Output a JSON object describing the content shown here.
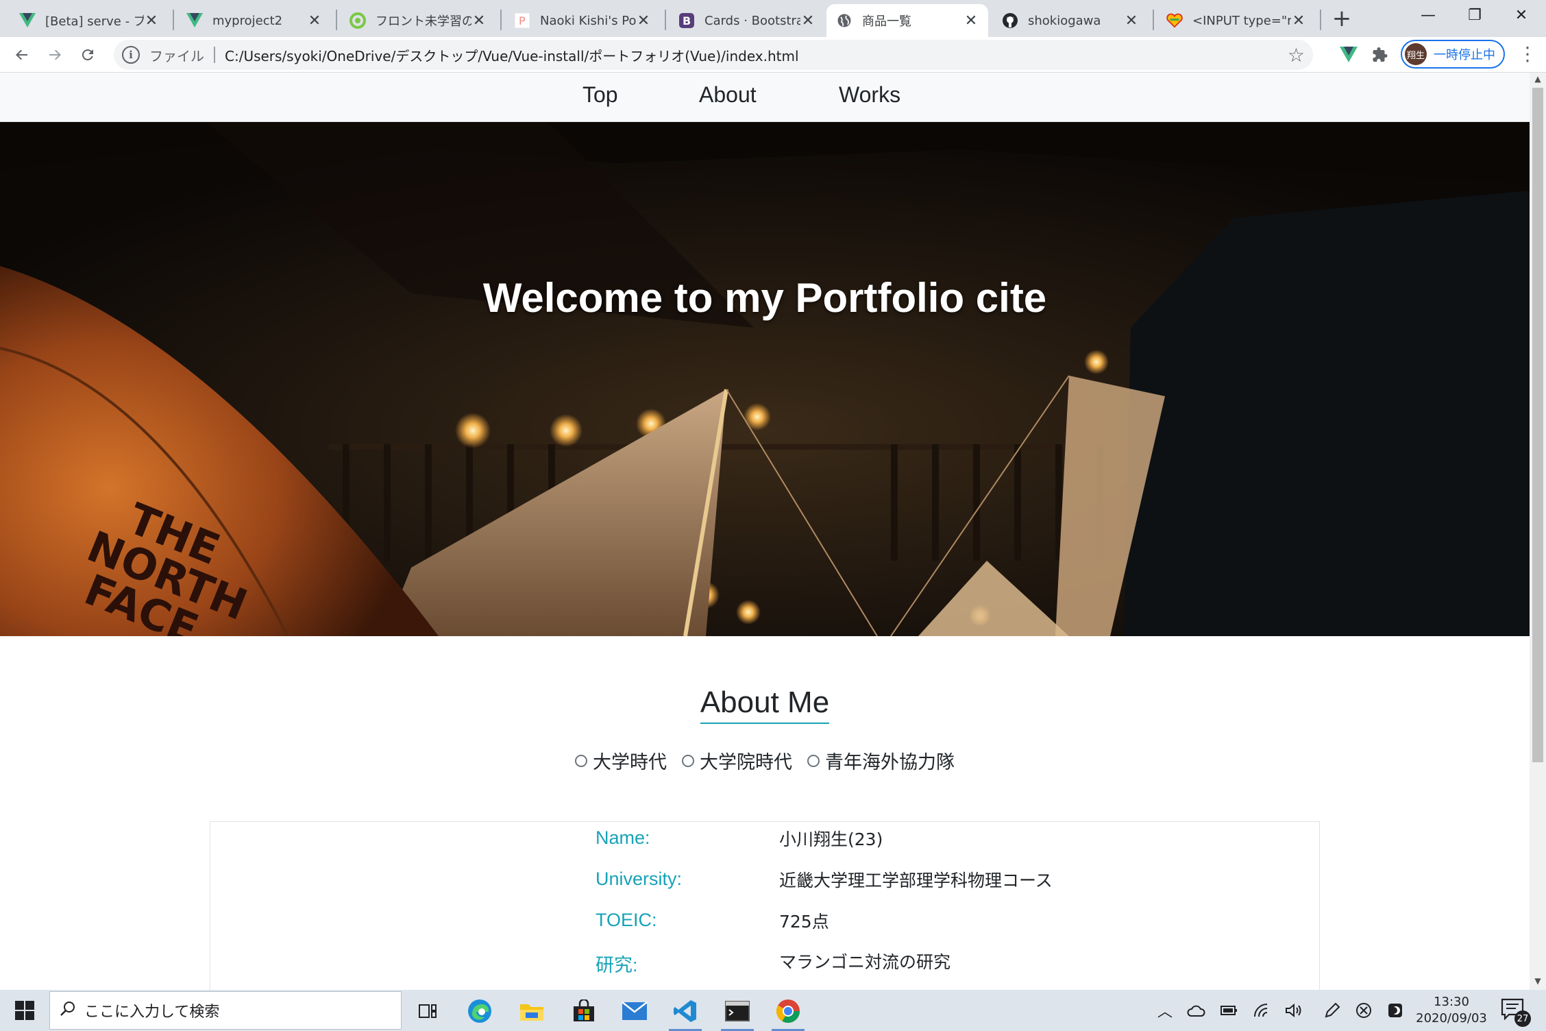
{
  "browser": {
    "tabs": [
      {
        "title": "[Beta] serve - プロ",
        "icon": "vue-icon",
        "active": false
      },
      {
        "title": "myproject2",
        "icon": "vue-icon",
        "active": false
      },
      {
        "title": "フロント未学習の大",
        "icon": "green-circle-icon",
        "active": false
      },
      {
        "title": "Naoki Kishi's Portf",
        "icon": "p-letter-icon",
        "active": false
      },
      {
        "title": "Cards · Bootstrap",
        "icon": "bootstrap-icon",
        "active": false
      },
      {
        "title": "商品一覧",
        "icon": "globe-icon",
        "active": true
      },
      {
        "title": "shokiogawa",
        "icon": "github-icon",
        "active": false
      },
      {
        "title": "<INPUT type=\"ra",
        "icon": "heart-icon",
        "active": false
      }
    ],
    "close_glyph": "✕",
    "new_tab_glyph": "+",
    "window_controls": {
      "minimize": "—",
      "restore": "❐",
      "close": "✕"
    },
    "address": {
      "scheme_label": "ファイル",
      "url": "C:/Users/syoki/OneDrive/デスクトップ/Vue/Vue-install/ポートフォリオ(Vue)/index.html"
    },
    "profile": {
      "avatar_text": "翔生",
      "label": "一時停止中"
    }
  },
  "page": {
    "nav": [
      "Top",
      "About",
      "Works"
    ],
    "hero_title": "Welcome to my Portfolio cite",
    "hero_tent_text": [
      "THE",
      "NORTH",
      "FACE"
    ],
    "about_title": "About Me",
    "radio_options": [
      "大学時代",
      "大学院時代",
      "青年海外協力隊"
    ],
    "profile_rows": [
      {
        "label": "Name:",
        "value": "小川翔生(23)"
      },
      {
        "label": "University:",
        "value": "近畿大学理工学部理学科物理コース"
      },
      {
        "label": "TOEIC:",
        "value": "725点"
      },
      {
        "label": "研究:",
        "value": "マランゴニ対流の研究"
      }
    ]
  },
  "taskbar": {
    "search_placeholder": "ここに入力して検索",
    "time": "13:30",
    "date": "2020/09/03",
    "notification_count": "27"
  }
}
